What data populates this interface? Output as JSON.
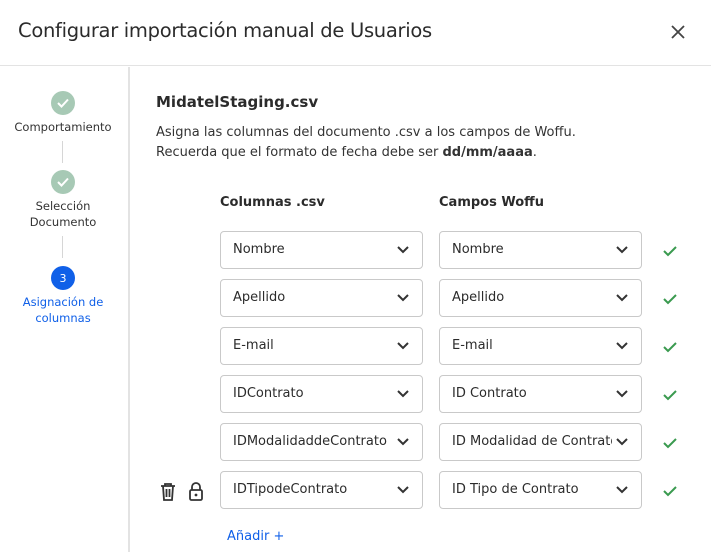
{
  "header": {
    "title": "Configurar importación manual de Usuarios"
  },
  "sidebar": {
    "steps": [
      {
        "label_1": "Comportamiento",
        "label_2": ""
      },
      {
        "label_1": "Selección",
        "label_2": "Documento"
      },
      {
        "number": "3",
        "label_1": "Asignación de",
        "label_2": "columnas"
      }
    ]
  },
  "main": {
    "filename": "MidatelStaging.csv",
    "description_line1": "Asigna las columnas del documento .csv a los campos de Woffu.",
    "description_line2_prefix": "Recuerda que el formato de fecha debe ser ",
    "description_line2_bold": "dd/mm/aaaa",
    "description_line2_suffix": ".",
    "col_csv_header": "Columnas .csv",
    "col_woffu_header": "Campos Woffu",
    "rows": [
      {
        "csv": "Nombre",
        "woffu": "Nombre"
      },
      {
        "csv": "Apellido",
        "woffu": "Apellido"
      },
      {
        "csv": "E-mail",
        "woffu": "E-mail"
      },
      {
        "csv": "IDContrato",
        "woffu": "ID Contrato"
      },
      {
        "csv": "IDModalidaddeContrato",
        "woffu": "ID Modalidad de Contrato"
      },
      {
        "csv": "IDTipodeContrato",
        "woffu": "ID Tipo de Contrato"
      }
    ],
    "add_label": "Añadir +"
  },
  "colors": {
    "accent": "#1060e8",
    "check": "#3a9a4f",
    "done_step": "#a7c9b5"
  }
}
